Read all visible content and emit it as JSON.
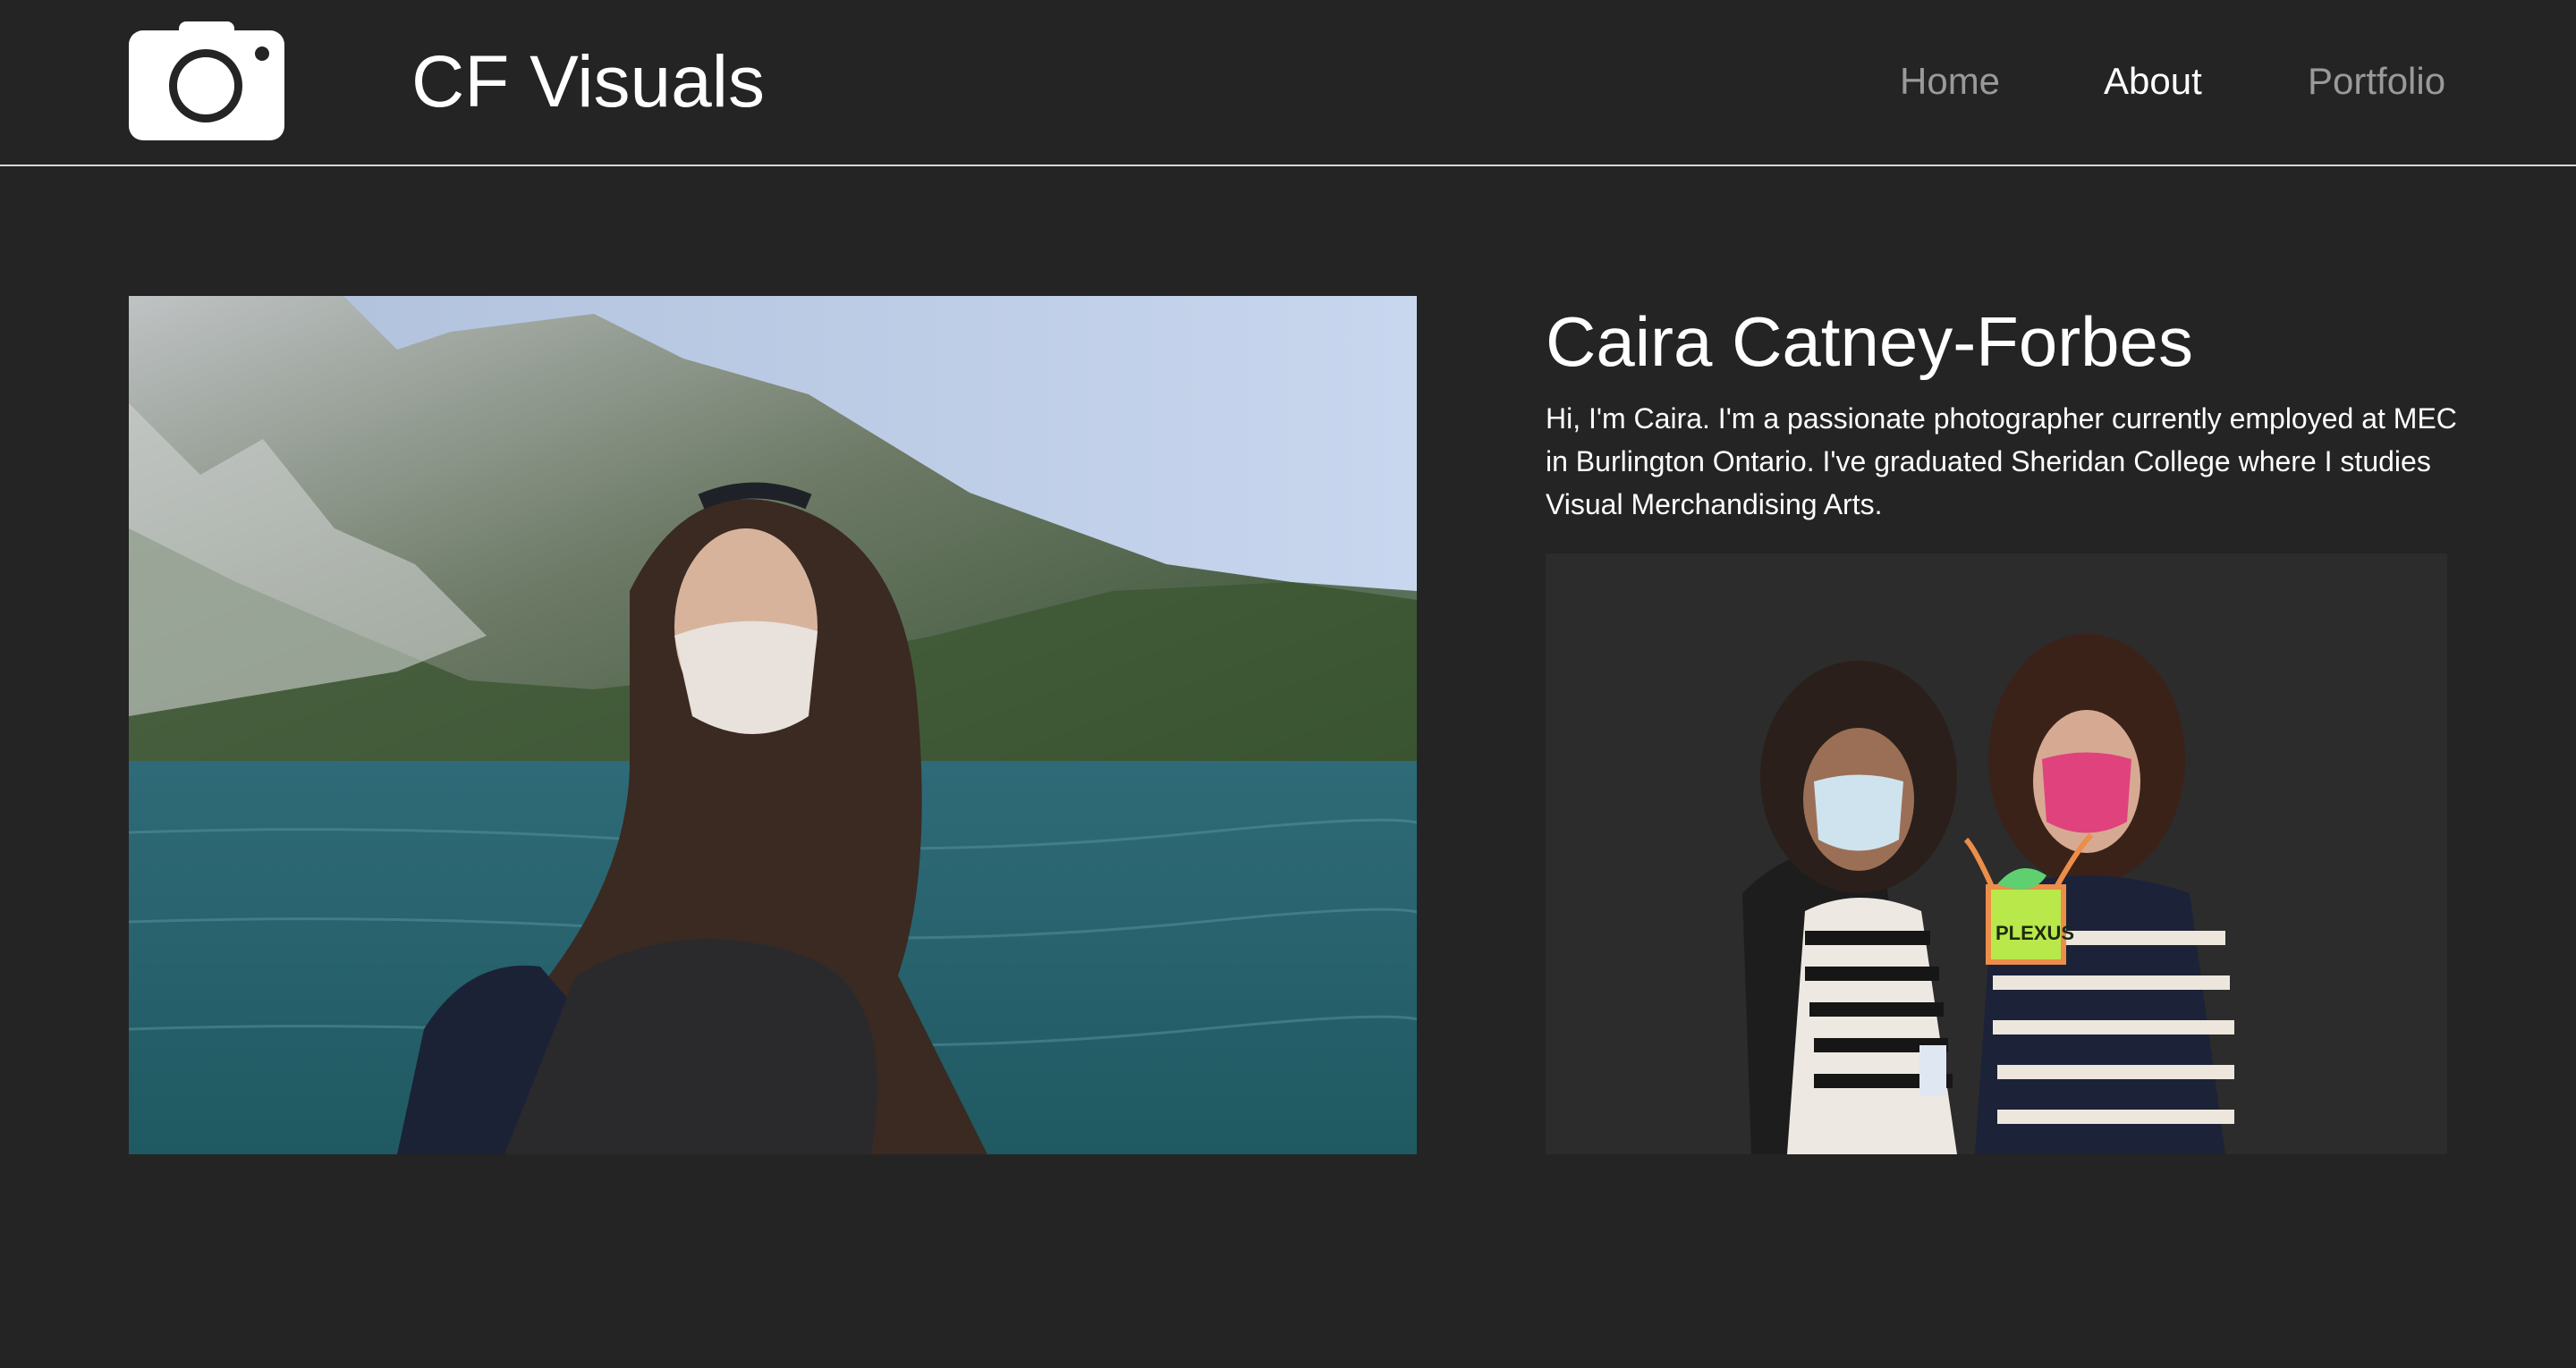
{
  "header": {
    "logo_icon": "camera-icon",
    "brand": "CF Visuals",
    "nav": [
      {
        "label": "Home",
        "active": false
      },
      {
        "label": "About",
        "active": true
      },
      {
        "label": "Portfolio",
        "active": false
      }
    ]
  },
  "about": {
    "name": "Caira Catney-Forbes",
    "bio": "Hi, I'm Caira. I'm a passionate photographer currently employed at MEC in Burlington Ontario. I've graduated Sheridan College where I studies Visual Merchandising Arts."
  },
  "images": {
    "main_photo": "portrait-lake-mountain-photo",
    "side_photo": "award-plexus-photo",
    "award_text": "PLEXUS"
  },
  "colors": {
    "background": "#242424",
    "text": "#ffffff",
    "nav_inactive": "#9a9a9a",
    "rule": "#d8d8d8"
  }
}
